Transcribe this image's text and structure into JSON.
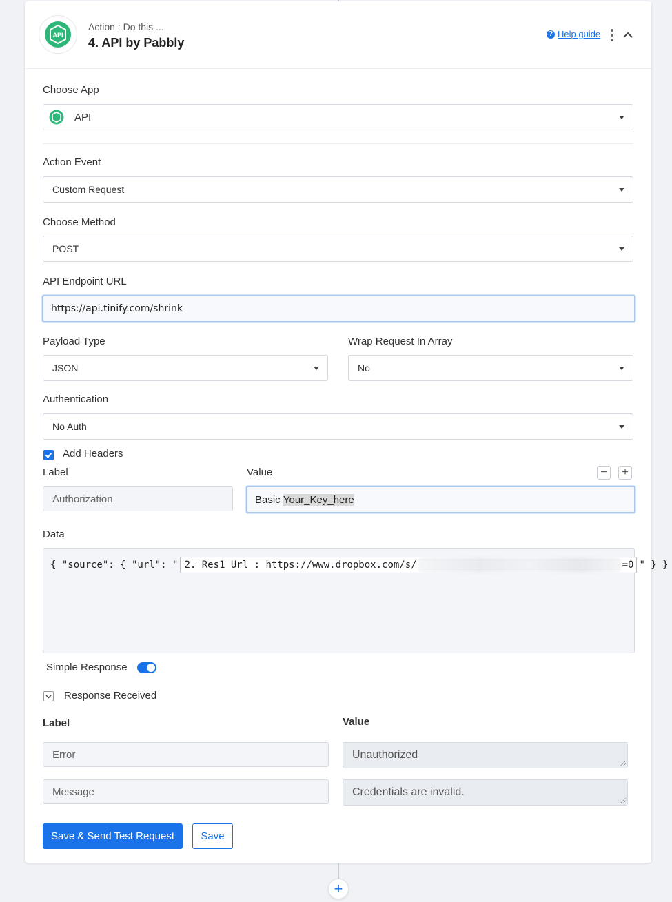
{
  "header": {
    "subtitle": "Action : Do this ...",
    "title": "4. API by Pabbly",
    "help_label": "Help guide",
    "help_icon_glyph": "?"
  },
  "choose_app": {
    "label": "Choose App",
    "value": "API",
    "logo_text": "API"
  },
  "action_event": {
    "label": "Action Event",
    "value": "Custom Request"
  },
  "choose_method": {
    "label": "Choose Method",
    "value": "POST"
  },
  "endpoint": {
    "label": "API Endpoint URL",
    "value": "https://api.tinify.com/shrink"
  },
  "payload_type": {
    "label": "Payload Type",
    "value": "JSON"
  },
  "wrap_request": {
    "label": "Wrap Request In Array",
    "value": "No"
  },
  "authentication": {
    "label": "Authentication",
    "value": "No Auth"
  },
  "headers": {
    "checkbox_label": "Add Headers",
    "checked": true,
    "label_col": "Label",
    "value_col": "Value",
    "minus_glyph": "−",
    "plus_glyph": "+",
    "row": {
      "label": "Authorization",
      "value_prefix": "Basic ",
      "value_highlight": "Your_Key_here"
    }
  },
  "data": {
    "label": "Data",
    "prefix": "{ \"source\": { \"url\": \"",
    "token_text": "2. Res1 Url : https://www.dropbox.com/s/",
    "token_tail": "=0",
    "suffix": "\" } }"
  },
  "simple_response": {
    "label": "Simple Response",
    "enabled": true
  },
  "response_received": {
    "label": "Response Received",
    "label_col": "Label",
    "value_col": "Value",
    "rows": [
      {
        "label": "Error",
        "value": "Unauthorized"
      },
      {
        "label": "Message",
        "value": "Credentials are invalid."
      }
    ]
  },
  "buttons": {
    "save_test": "Save & Send Test Request",
    "save": "Save"
  },
  "add_step_glyph": "+",
  "colors": {
    "accent": "#1a73e8",
    "app_green": "#2fb77a"
  }
}
